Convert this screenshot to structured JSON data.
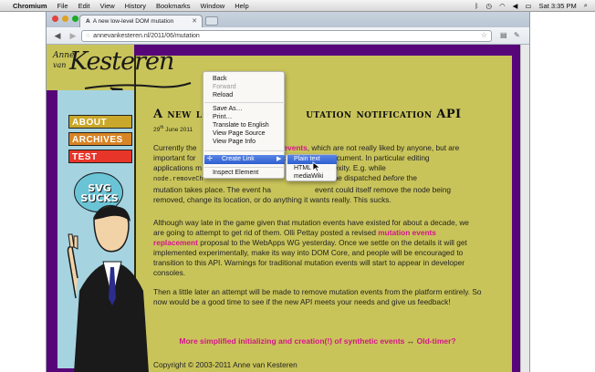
{
  "menubar": {
    "app": "Chromium",
    "items": [
      "File",
      "Edit",
      "View",
      "History",
      "Bookmarks",
      "Window",
      "Help"
    ],
    "clock": "Sat 3:35 PM"
  },
  "browser": {
    "tab_title": "A new low-level DOM mutation",
    "url": "annevankesteren.nl/2011/06/mutation"
  },
  "logo": {
    "anne": "Anne",
    "van": "van",
    "kesteren": "Kesteren"
  },
  "nav": {
    "about": "ABOUT",
    "archives": "ARCHIVES",
    "test": "TEST",
    "colors": {
      "about": "#c9a72a",
      "archives": "#d88424",
      "test": "#e8352a"
    }
  },
  "bubble": {
    "line1": "SVG",
    "line2": "SUCKS"
  },
  "article": {
    "title_start": "A new low",
    "title_end": "utation notification API",
    "date_day": "29",
    "date_sup": "th",
    "date_rest": "June 2011",
    "p1_a": "Currently the",
    "p1_link": "events",
    "p1_b": ", which are not really liked by anyone, but are",
    "p1_c": "important for",
    "p1_d": "changes to a document. In particular editing",
    "p1_e": "applications m",
    "p1_f": "m their complexity. E.g. while",
    "p1_code": "node.removeCh",
    "p1_g": "ent needs to be dispatched",
    "p1_before": "before",
    "p1_h": "the",
    "p1_i": "mutation takes place. The event ha",
    "p1_j": "event could itself remove the node being",
    "p1_k": "removed, change its location, or do anything it wants really. This sucks.",
    "p2_a": "Although way late in the game given that mutation events have existed for about a decade, we are going to attempt to get rid of them. Olli Pettay posted a revised",
    "p2_link": "mutation events replacement",
    "p2_b": "proposal to the WebApps WG yesterday. Once we settle on the details it will get implemented experimentally, make its way into DOM Core, and people will be encouraged to transition to this API. Warnings for traditional mutation events will start to appear in developer consoles.",
    "p3": "Then a little later an attempt will be made to remove mutation events from the platform entirely. So now would be a good time to see if the new API meets your needs and give us feedback!",
    "more_link": "More simplified initializing and creation(!) of synthetic events",
    "arrow": "↔",
    "old_link": "Old-timer?",
    "copyright": "Copyright © 2003-2011 Anne van Kesteren"
  },
  "context_menu": {
    "back": "Back",
    "forward": "Forward",
    "reload": "Reload",
    "save_as": "Save As…",
    "print": "Print…",
    "translate": "Translate to English",
    "view_source": "View Page Source",
    "view_info": "View Page Info",
    "create_link": "Create Link",
    "inspect": "Inspect Element"
  },
  "submenu": {
    "plain_text": "Plain text",
    "html": "HTML",
    "mediawiki": "mediaWiki"
  }
}
